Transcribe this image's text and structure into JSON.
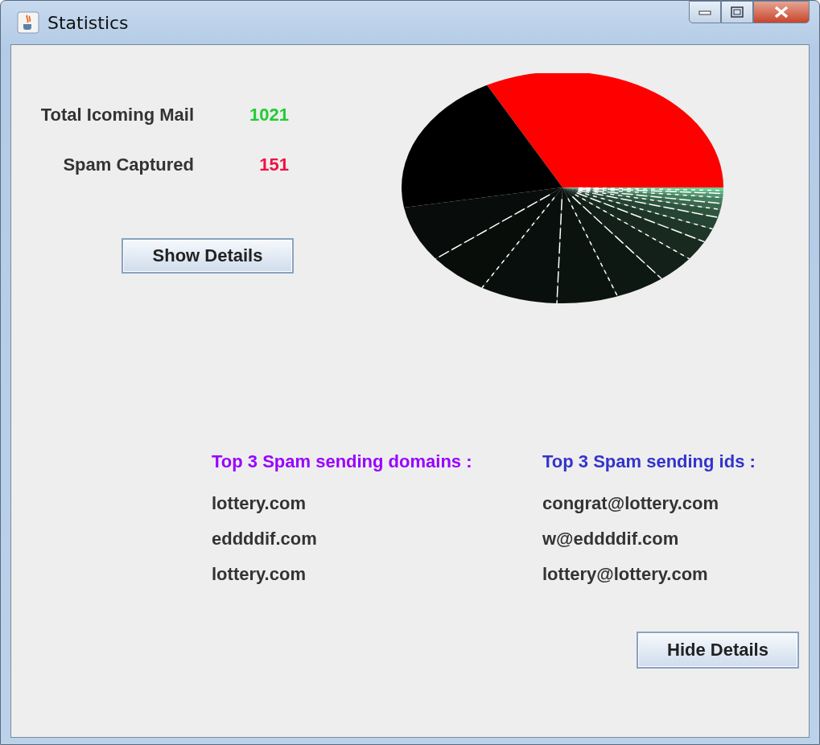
{
  "window": {
    "title": "Statistics"
  },
  "stats": [
    {
      "label": "Total Icoming Mail",
      "value": "1021",
      "color": "#22cc33"
    },
    {
      "label": "Spam Captured",
      "value": "151",
      "color": "#ee1144"
    }
  ],
  "show_button": "Show Details",
  "lists": [
    {
      "heading": "Top 3 Spam sending domains :",
      "color": "#9900ff",
      "items": [
        "lottery.com",
        "eddddif.com",
        "lottery.com"
      ]
    },
    {
      "heading": "Top 3 Spam sending ids :",
      "color": "#3333cc",
      "items": [
        "congrat@lottery.com",
        "w@eddddif.com",
        "lottery@lottery.com"
      ]
    }
  ],
  "hide_button": "Hide Details"
}
